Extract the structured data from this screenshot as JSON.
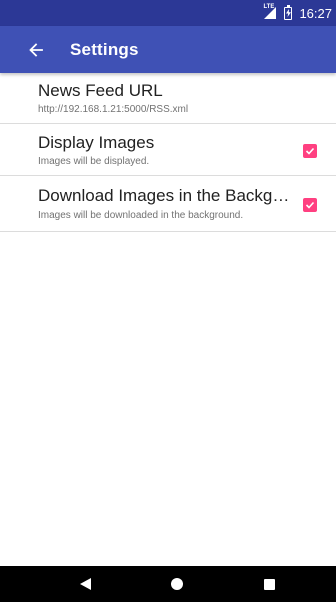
{
  "status_bar": {
    "network_label": "LTE",
    "time": "16:27",
    "colors": {
      "background": "#2c3896"
    },
    "icons": [
      "signal-icon",
      "battery-charging-icon"
    ]
  },
  "app_bar": {
    "title": "Settings",
    "back_icon": "arrow-left-icon",
    "colors": {
      "background": "#3f51b5"
    }
  },
  "preferences": [
    {
      "title": "News Feed URL",
      "summary": "http://192.168.1.21:5000/RSS.xml",
      "has_checkbox": false
    },
    {
      "title": "Display Images",
      "summary": "Images will be displayed.",
      "has_checkbox": true,
      "checked": true
    },
    {
      "title": "Download Images in the Background",
      "summary": "Images will be downloaded in the background.",
      "has_checkbox": true,
      "checked": true
    }
  ],
  "nav_bar": {
    "buttons": [
      "back-triangle-icon",
      "home-circle-icon",
      "recents-square-icon"
    ]
  },
  "colors": {
    "accent": "#ff4081",
    "primary": "#3f51b5",
    "primary_dark": "#2c3896"
  }
}
